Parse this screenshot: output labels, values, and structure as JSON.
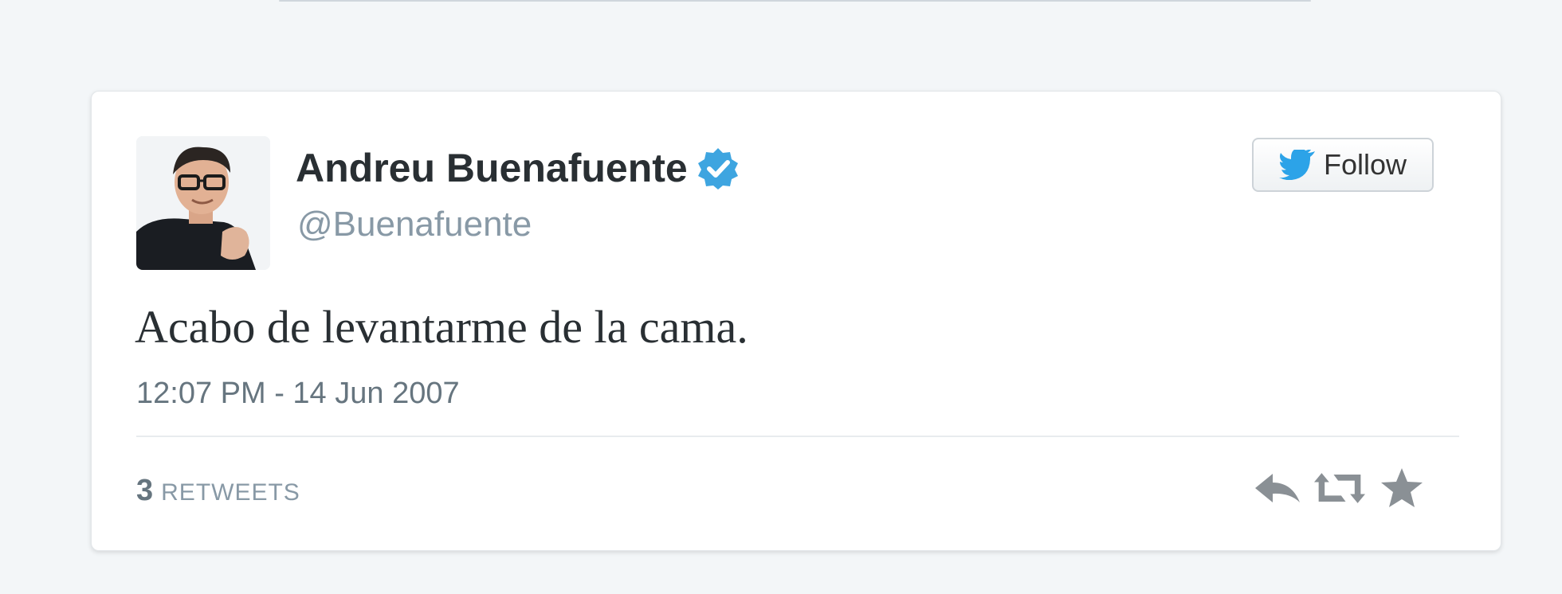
{
  "tweet": {
    "author": {
      "name": "Andreu Buenafuente",
      "handle": "@Buenafuente",
      "verified": true
    },
    "follow_button": {
      "label": "Follow",
      "icon": "twitter-bird-icon"
    },
    "text": "Acabo de levantarme de la cama.",
    "timestamp": "12:07 PM - 14 Jun 2007",
    "stats": {
      "retweets_count": "3",
      "retweets_label": "RETWEETS"
    },
    "actions": [
      {
        "icon": "reply-icon"
      },
      {
        "icon": "retweet-icon"
      },
      {
        "icon": "favorite-star-icon"
      }
    ]
  },
  "colors": {
    "verified_badge": "#3ea5e0",
    "twitter_blue": "#2ca3e8",
    "text_primary": "#292f33",
    "text_secondary": "#8899a6",
    "icon_gray": "#8a9095"
  }
}
